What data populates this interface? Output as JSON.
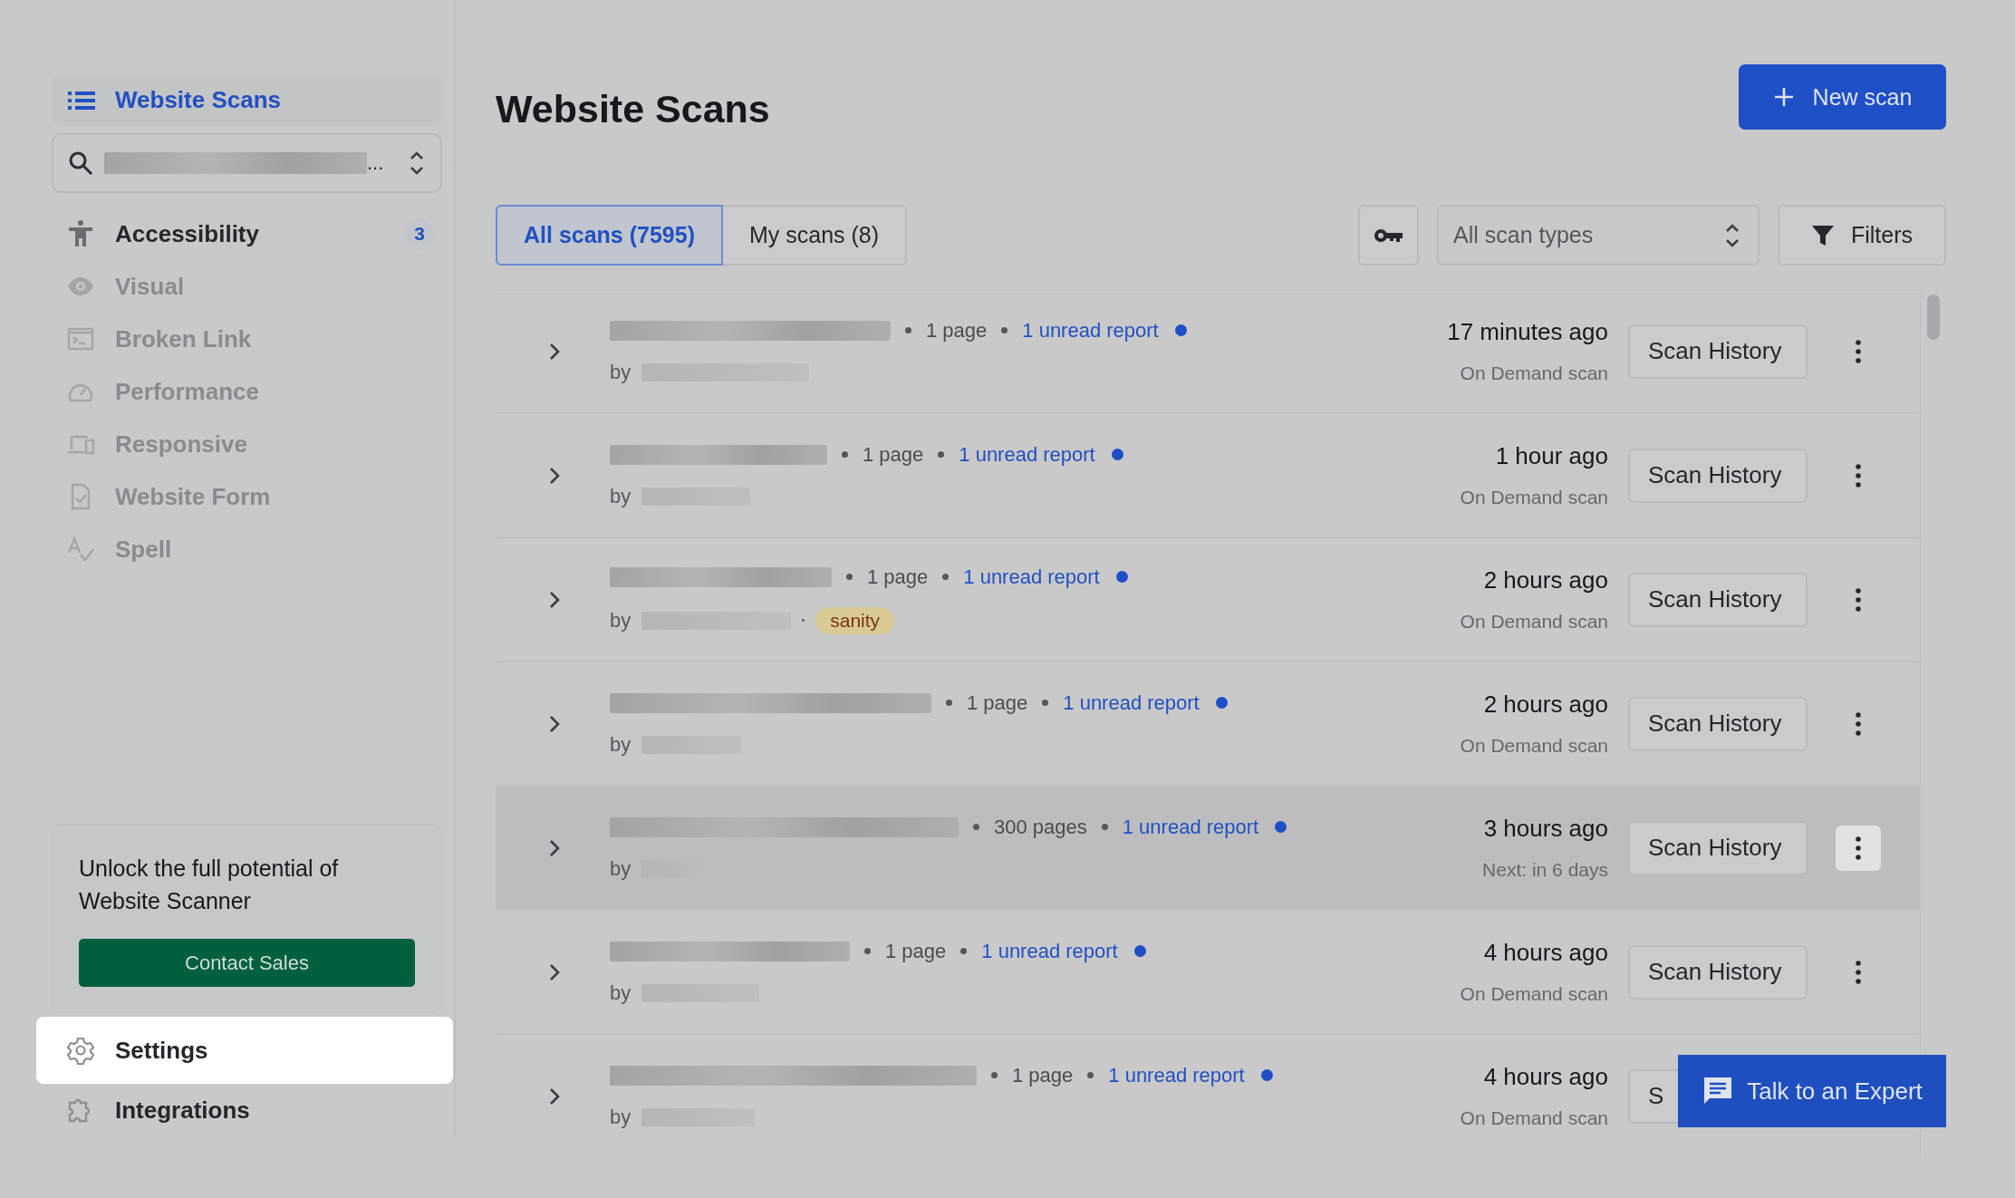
{
  "sidebar": {
    "header": {
      "label": "Website Scans",
      "selected": true
    },
    "search": {
      "value": "..."
    },
    "items": [
      {
        "label": "Accessibility",
        "selected": true,
        "badge": "3"
      },
      {
        "label": "Visual",
        "selected": false
      },
      {
        "label": "Broken Link",
        "selected": false
      },
      {
        "label": "Performance",
        "selected": false
      },
      {
        "label": "Responsive",
        "selected": false
      },
      {
        "label": "Website Form",
        "selected": false
      },
      {
        "label": "Spell",
        "selected": false
      }
    ],
    "promo": {
      "text": "Unlock the full potential of Website Scanner",
      "button": "Contact Sales"
    },
    "bottom_items": [
      {
        "label": "Settings",
        "highlighted": true
      },
      {
        "label": "Integrations",
        "highlighted": false
      }
    ]
  },
  "header": {
    "title": "Website Scans",
    "new_button": "New scan"
  },
  "tabs": [
    {
      "label": "All scans (7595)",
      "selected": true
    },
    {
      "label": "My scans (8)",
      "selected": false
    }
  ],
  "scan_type_select": {
    "value": "All scan types"
  },
  "filters_button": "Filters",
  "rows": [
    {
      "meta": "1 page",
      "report": "1 unread report",
      "unread": true,
      "by": "by",
      "time": "17 minutes ago",
      "schedule": "On Demand scan",
      "button": "Scan History",
      "hovered": false
    },
    {
      "meta": "1 page",
      "report": "1 unread report",
      "unread": true,
      "by": "by",
      "time": "1 hour ago",
      "schedule": "On Demand scan",
      "button": "Scan History",
      "hovered": false
    },
    {
      "meta": "1 page",
      "report": "1 unread report",
      "unread": true,
      "by": "by",
      "tag": "sanity",
      "time": "2 hours ago",
      "schedule": "On Demand scan",
      "button": "Scan History",
      "hovered": false
    },
    {
      "meta": "1 page",
      "report": "1 unread report",
      "unread": true,
      "by": "by",
      "time": "2 hours ago",
      "schedule": "On Demand scan",
      "button": "Scan History",
      "hovered": false
    },
    {
      "meta": "300 pages",
      "report": "1 unread report",
      "unread": true,
      "by": "by",
      "time": "3 hours ago",
      "schedule": "Next: in 6 days",
      "button": "Scan History",
      "hovered": true
    },
    {
      "meta": "1 page",
      "report": "1 unread report",
      "unread": true,
      "by": "by",
      "time": "4 hours ago",
      "schedule": "On Demand scan",
      "button": "Scan History",
      "hovered": false
    },
    {
      "meta": "1 page",
      "report": "1 unread report",
      "unread": true,
      "by": "by",
      "time": "4 hours ago",
      "schedule": "On Demand scan",
      "button": "S"
    }
  ],
  "chat_button": "Talk to an Expert"
}
